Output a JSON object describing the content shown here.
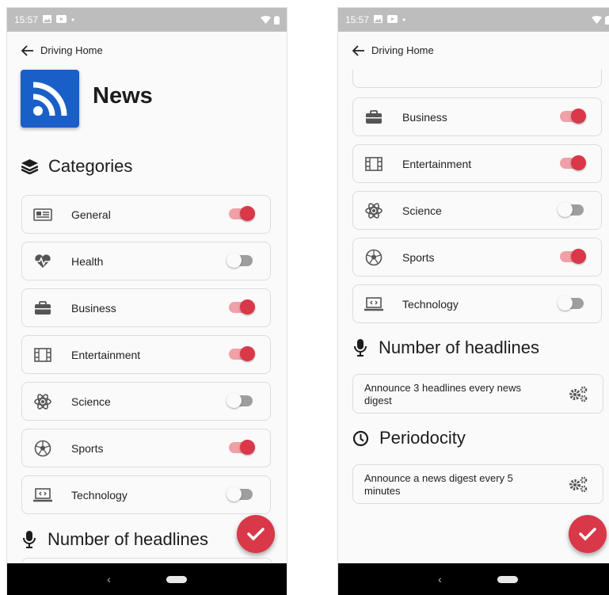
{
  "status_bar": {
    "time": "15:57"
  },
  "nav": {
    "back_title": "Driving Home"
  },
  "app": {
    "title": "News"
  },
  "sections": {
    "categories": "Categories",
    "headlines": "Number of headlines",
    "periodicity": "Periodocity"
  },
  "categories": [
    {
      "label": "General",
      "icon": "newspaper-icon",
      "enabled": true
    },
    {
      "label": "Health",
      "icon": "heart-pulse-icon",
      "enabled": false
    },
    {
      "label": "Business",
      "icon": "briefcase-icon",
      "enabled": true
    },
    {
      "label": "Entertainment",
      "icon": "film-icon",
      "enabled": true
    },
    {
      "label": "Science",
      "icon": "atom-icon",
      "enabled": false
    },
    {
      "label": "Sports",
      "icon": "soccer-ball-icon",
      "enabled": true
    },
    {
      "label": "Technology",
      "icon": "laptop-code-icon",
      "enabled": false
    }
  ],
  "headlines_setting": {
    "text": "Announce 3 headlines every news digest"
  },
  "periodicity_setting": {
    "text": "Announce a news digest every 5 minutes"
  },
  "colors": {
    "accent": "#d93848",
    "logo": "#1a5fc8",
    "statusbar": "#bdbdbd"
  }
}
